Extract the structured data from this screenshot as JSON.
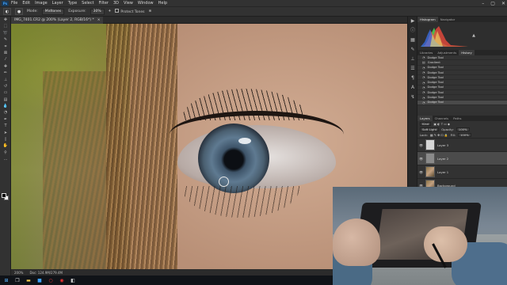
{
  "app": {
    "logo": "Ps"
  },
  "menu": [
    "File",
    "Edit",
    "Image",
    "Layer",
    "Type",
    "Select",
    "Filter",
    "3D",
    "View",
    "Window",
    "Help"
  ],
  "window_controls": [
    "–",
    "▢",
    "✕"
  ],
  "options_bar": {
    "mode_label": "Mode:",
    "mode_value": "Midtones",
    "exposure_label": "Exposure:",
    "exposure_value": "30%",
    "protect_tones_label": "Protect Tones"
  },
  "document": {
    "tab_title": "IMG_7401.CR2 @ 200% (Layer 2, RGB/16*) *",
    "close": "×"
  },
  "status": {
    "zoom": "200%",
    "doc_info": "Doc: 124.9M/279.4M"
  },
  "tools": [
    "move-icon",
    "marquee-icon",
    "lasso-icon",
    "quick-select-icon",
    "crop-icon",
    "eyedropper-icon",
    "healing-icon",
    "brush-icon",
    "clone-stamp-icon",
    "history-brush-icon",
    "eraser-icon",
    "gradient-icon",
    "blur-icon",
    "dodge-icon",
    "pen-icon",
    "type-icon",
    "path-select-icon",
    "rectangle-icon",
    "hand-icon",
    "zoom-icon"
  ],
  "panels": {
    "histogram_tabs": [
      "Histogram",
      "Navigator"
    ],
    "middle_tabs": [
      "Libraries",
      "Adjustments",
      "History"
    ],
    "history_items": [
      "Dodge Tool",
      "Gradient",
      "Dodge Tool",
      "Dodge Tool",
      "Dodge Tool",
      "Dodge Tool",
      "Dodge Tool",
      "Dodge Tool",
      "Dodge Tool",
      "Dodge Tool"
    ],
    "layers_tabs": [
      "Layers",
      "Channels",
      "Paths"
    ],
    "layers_kind": "Kind",
    "blend_mode": "Soft Light",
    "opacity_label": "Opacity:",
    "opacity_value": "100%",
    "lock_label": "Lock:",
    "fill_label": "Fill:",
    "fill_value": "100%",
    "layers": [
      {
        "name": "Layer 3",
        "selected": false,
        "thumb": "white"
      },
      {
        "name": "Layer 2",
        "selected": true,
        "thumb": "grey"
      },
      {
        "name": "Layer 1",
        "selected": false,
        "thumb": "photo"
      },
      {
        "name": "Background",
        "selected": false,
        "thumb": "photo"
      }
    ]
  },
  "colors": {
    "accent": "#3fa3ff",
    "histogram_red": "#e84a3c",
    "histogram_green": "#4ed152",
    "histogram_blue": "#3b6fe8"
  }
}
